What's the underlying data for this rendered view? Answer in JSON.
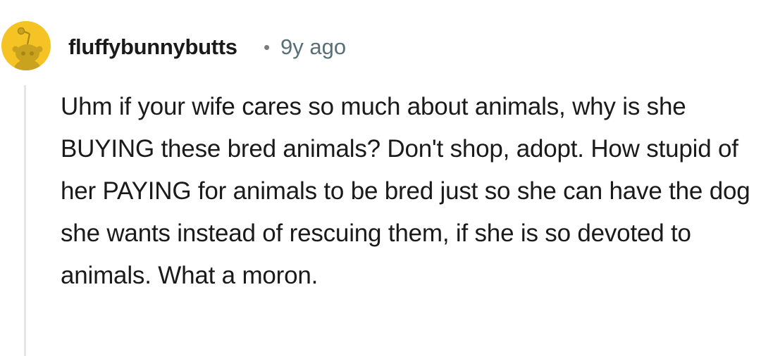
{
  "comment": {
    "author": "fluffybunnybutts",
    "separator": "•",
    "age": "9y ago",
    "avatar_icon": "reddit-snoo-avatar-icon",
    "accent_color": "#f6c324",
    "text": "Uhm if your wife cares so much about animals, why is she BUYING these bred animals? Don't shop, adopt. How stupid of her PAYING for animals to be bred just so she can have the dog she wants instead of rescuing them, if she is so devoted to animals. What a moron."
  }
}
